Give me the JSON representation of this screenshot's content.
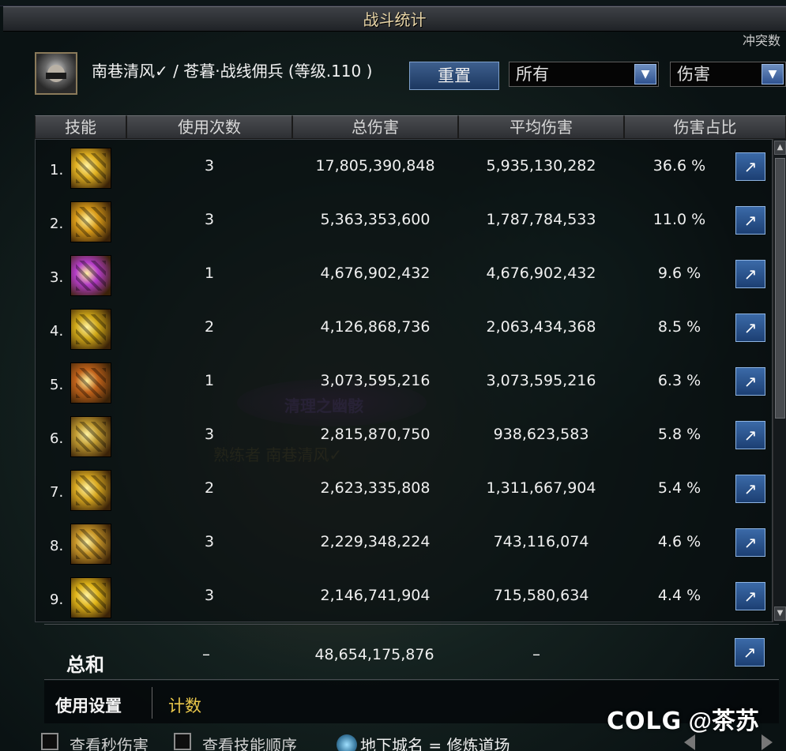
{
  "window": {
    "title": "战斗统计",
    "corner_text": "冲突数"
  },
  "character": {
    "name": "南巷清风✓ / 苍暮·战线佣兵 (等级.110 )"
  },
  "controls": {
    "reset_label": "重置",
    "filter_value": "所有",
    "metric_value": "伤害",
    "dropdown_arrow": "▼"
  },
  "columns": [
    "技能",
    "使用次数",
    "总伤害",
    "平均伤害",
    "伤害占比"
  ],
  "rows": [
    {
      "rank": "1.",
      "count": "3",
      "total": "17,805,390,848",
      "avg": "5,935,130,282",
      "pct": "36.6 %",
      "icon_color": "#e0b020"
    },
    {
      "rank": "2.",
      "count": "3",
      "total": "5,363,353,600",
      "avg": "1,787,784,533",
      "pct": "11.0 %",
      "icon_color": "#d89a18"
    },
    {
      "rank": "3.",
      "count": "1",
      "total": "4,676,902,432",
      "avg": "4,676,902,432",
      "pct": "9.6 %",
      "icon_color": "#b43cc8"
    },
    {
      "rank": "4.",
      "count": "2",
      "total": "4,126,868,736",
      "avg": "2,063,434,368",
      "pct": "8.5 %",
      "icon_color": "#d0a818"
    },
    {
      "rank": "5.",
      "count": "1",
      "total": "3,073,595,216",
      "avg": "3,073,595,216",
      "pct": "6.3 %",
      "icon_color": "#c0621a"
    },
    {
      "rank": "6.",
      "count": "3",
      "total": "2,815,870,750",
      "avg": "938,623,583",
      "pct": "5.8 %",
      "icon_color": "#c09a30"
    },
    {
      "rank": "7.",
      "count": "2",
      "total": "2,623,335,808",
      "avg": "1,311,667,904",
      "pct": "5.4 %",
      "icon_color": "#d8a820"
    },
    {
      "rank": "8.",
      "count": "3",
      "total": "2,229,348,224",
      "avg": "743,116,074",
      "pct": "4.6 %",
      "icon_color": "#c89628"
    },
    {
      "rank": "9.",
      "count": "3",
      "total": "2,146,741,904",
      "avg": "715,580,634",
      "pct": "4.4 %",
      "icon_color": "#e0b418"
    }
  ],
  "share_icon": "↗",
  "total": {
    "label": "总和",
    "count": "–",
    "total": "48,654,175,876",
    "avg": "–"
  },
  "tabs": {
    "settings": "使用设置",
    "count": "计数"
  },
  "bottom": {
    "show_per_second": "查看秒伤害",
    "show_skill_order": "查看技能顺序",
    "dungeon": "地下城名 = 修炼道场"
  },
  "background_text": {
    "title": "清理之幽骸",
    "player": "熟练者 南巷清风✓"
  },
  "watermark": {
    "logo": "COLG",
    "user": "@茶苏"
  }
}
